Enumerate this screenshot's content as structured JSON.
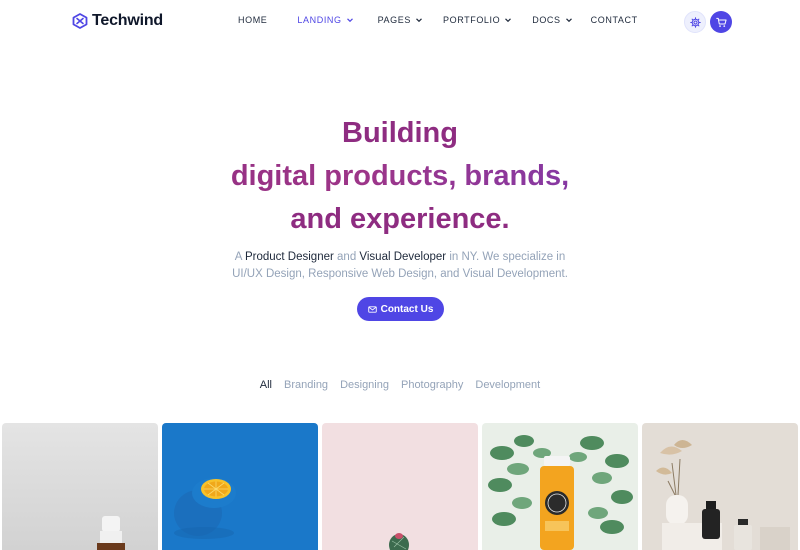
{
  "brand": {
    "name": "Techwind",
    "accent": "#4f46e5",
    "heading": "#8e2c81"
  },
  "nav": {
    "items": [
      {
        "label": "Home",
        "dropdown": false,
        "active": false
      },
      {
        "label": "Landing",
        "dropdown": true,
        "active": true
      },
      {
        "label": "Pages",
        "dropdown": true,
        "active": false
      },
      {
        "label": "Portfolio",
        "dropdown": true,
        "active": false
      },
      {
        "label": "Docs",
        "dropdown": true,
        "active": false
      },
      {
        "label": "Contact",
        "dropdown": false,
        "active": false
      }
    ],
    "settings_icon": "gear-icon",
    "cart_icon": "cart-icon"
  },
  "hero": {
    "title_line1": "Building",
    "title_line2": "digital products, brands,",
    "title_line3": "and experience.",
    "desc_prefix": "A ",
    "desc_role1": "Product Designer",
    "desc_and": " and ",
    "desc_role2": "Visual Developer",
    "desc_rest1": " in NY. We specialize in",
    "desc_line2": "UI/UX Design, Responsive Web Design, and Visual Development.",
    "cta_label": "Contact Us",
    "cta_icon": "mail-icon"
  },
  "filters": {
    "items": [
      "All",
      "Branding",
      "Designing",
      "Photography",
      "Development"
    ],
    "active_index": 0
  },
  "gallery": {
    "tiles": [
      {
        "subject": "dropper-bottle"
      },
      {
        "subject": "blue-orange"
      },
      {
        "subject": "cactus"
      },
      {
        "subject": "juice-bottle-plants"
      },
      {
        "subject": "dried-flowers-vase"
      }
    ]
  }
}
